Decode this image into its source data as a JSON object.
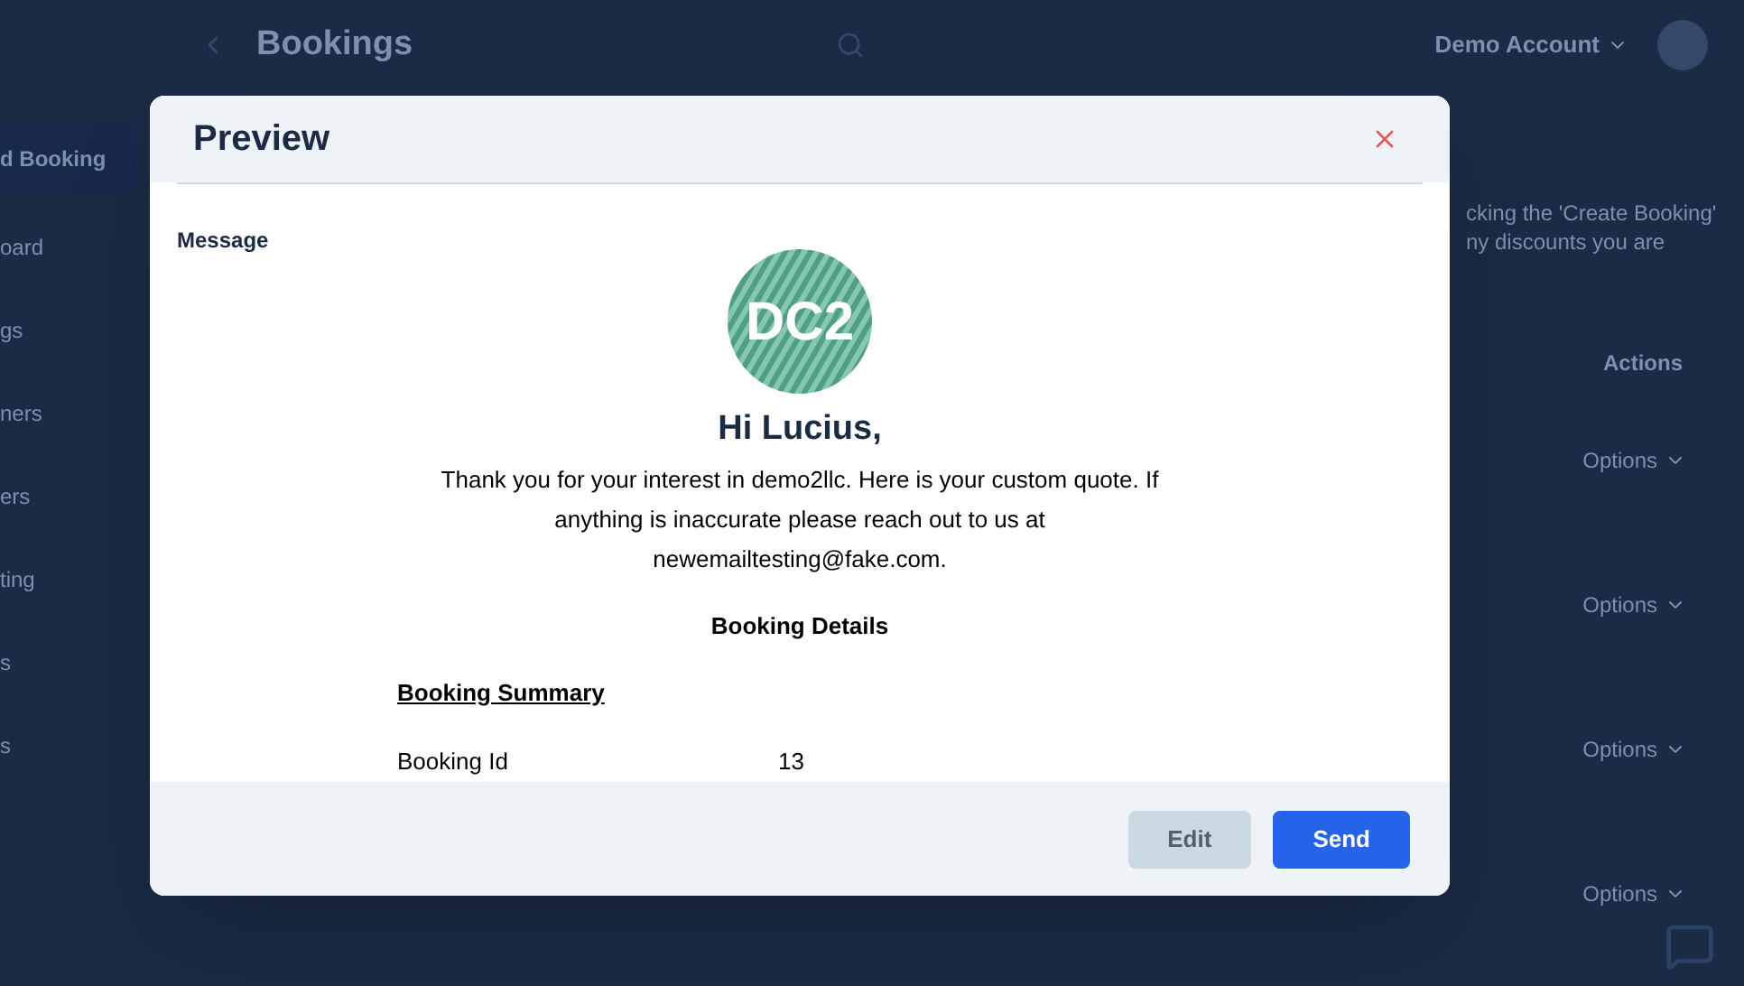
{
  "page": {
    "title": "Bookings",
    "account": "Demo Account",
    "sidebar": [
      "d Booking",
      "oard",
      "gs",
      "ners",
      "ers",
      "ting",
      "s",
      "s"
    ],
    "intro": [
      "cking the 'Create Booking'",
      "ny discounts you are"
    ],
    "table_header": "Actions",
    "row_actions": [
      "Options",
      "Options",
      "Options",
      "Options"
    ]
  },
  "dialog": {
    "title": "Preview",
    "message_label": "Message",
    "logo_text": "DC2",
    "greeting": "Hi Lucius,",
    "body": "Thank you for your interest in demo2llc. Here is your custom quote. If anything is inaccurate please reach out to us at newemailtesting@fake.com.",
    "section_title": "Booking Details",
    "summary_title": "Booking Summary",
    "rows": [
      {
        "label": "Booking Id",
        "value": "13"
      }
    ],
    "buttons": [
      {
        "label": "Edit",
        "kind": "secondary"
      },
      {
        "label": "Send",
        "kind": "primary"
      }
    ]
  }
}
